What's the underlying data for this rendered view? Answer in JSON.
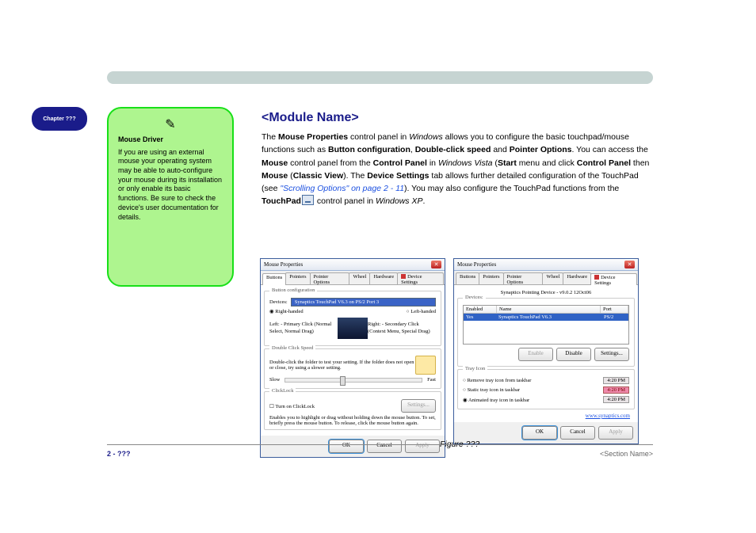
{
  "header": {
    "chapter_badge": "Chapter ???"
  },
  "sidebar": {
    "title": "Mouse Driver",
    "body": "If you are using an external mouse your operating system may be able to auto-configure your mouse during its installation or only enable its basic functions. Be sure to check the device's user documentation for details."
  },
  "module_heading": "<Module Name>",
  "body_text": {
    "p1_a": "The ",
    "p1_b": "Mouse Properties",
    "p1_c": " control panel in ",
    "p1_d": "Windows",
    "p1_e": " allows you to configure the basic touchpad/mouse functions such as ",
    "p1_f": "Button configuration",
    "p1_g": ", ",
    "p1_h": "Double-click speed",
    "p1_i": " and ",
    "p1_j": "Pointer Options",
    "p1_k": ". You can access the ",
    "p1_l": "Mouse",
    "p1_m": " control panel from the ",
    "p1_n": "Control Panel",
    "p1_o": " in ",
    "p1_p": "Windows Vista",
    "p1_q": " (",
    "p1_r": "Start",
    "p1_s": " menu and click ",
    "p1_t": "Control Panel",
    "p1_u": " then ",
    "p1_v": "Mouse",
    "p1_w": " (",
    "p1_x": "Classic View",
    "p1_y": "). The ",
    "p1_z": "Device Settings",
    "p1_aa": " tab allows further detailed configuration of the TouchPad (see ",
    "p1_ab": "\"Scrolling Options\" on page 2 - 11",
    "p1_ac": "). You may also configure the TouchPad functions from the ",
    "p1_ad": "TouchPad",
    "p1_ae": " control panel in ",
    "p1_af": "Windows XP",
    "p1_ag": "."
  },
  "dialog1": {
    "title": "Mouse Properties",
    "tabs": [
      "Buttons",
      "Pointers",
      "Pointer Options",
      "Wheel",
      "Hardware",
      "Device Settings"
    ],
    "group_buttonconf": "Button configuration",
    "devices_label": "Devices:",
    "devices_value": "Synaptics TouchPad V6.3 on PS/2 Port 3",
    "right_handed": "Right-handed",
    "left_handed": "Left-handed",
    "left_col": "Left:\n- Primary Click (Normal Select, Normal Drag)",
    "right_col": "Right:\n- Secondary Click (Context Menu, Special Drag)",
    "group_dblclick": "Double Click Speed",
    "dblclick_text": "Double-click the folder to test your setting. If the folder does not open or close, try using a slower setting.",
    "slow": "Slow",
    "fast": "Fast",
    "group_clicklock": "ClickLock",
    "clicklock_chk": "Turn on ClickLock",
    "clicklock_desc": "Enables you to highlight or drag without holding down the mouse button. To set, briefly press the mouse button. To release, click the mouse button again.",
    "settings_btn": "Settings...",
    "ok": "OK",
    "cancel": "Cancel",
    "apply": "Apply"
  },
  "dialog2": {
    "title": "Mouse Properties",
    "tabs": [
      "Buttons",
      "Pointers",
      "Pointer Options",
      "Wheel",
      "Hardware",
      "Device Settings"
    ],
    "subtitle": "Synaptics Pointing Device - v9.0.2 12Oct06",
    "group_devices": "Devices:",
    "col_enabled": "Enabled",
    "col_name": "Name",
    "col_port": "Port",
    "row_enabled": "Yes",
    "row_name": "Synaptics TouchPad V6.3",
    "row_port": "PS/2",
    "enable": "Enable",
    "disable": "Disable",
    "settings": "Settings...",
    "group_tray": "Tray Icon",
    "tray_remove": "Remove tray icon from taskbar",
    "tray_static": "Static tray icon in taskbar",
    "tray_anim": "Animated tray icon in taskbar",
    "time1": "4:20 PM",
    "time2": "4:20 PM",
    "time3": "4:20 PM",
    "link": "www.synaptics.com",
    "ok": "OK",
    "cancel": "Cancel",
    "apply": "Apply"
  },
  "caption": "Figure ???",
  "footer": {
    "page": "2 - ???",
    "section": "<Section Name>"
  }
}
